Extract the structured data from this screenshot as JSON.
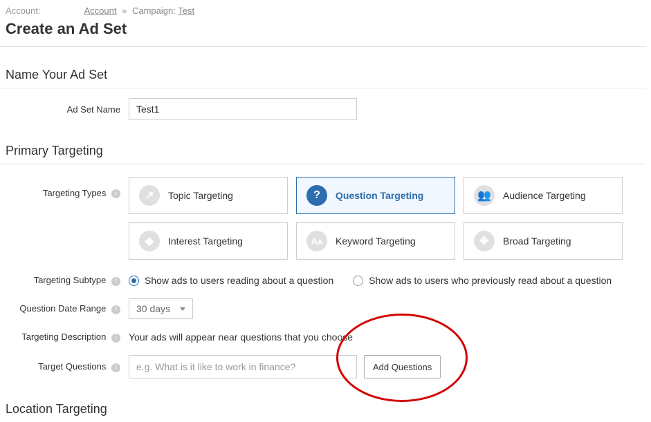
{
  "breadcrumb": {
    "label": "Account:",
    "account_link": "Account",
    "campaign_label": "Campaign:",
    "campaign_name": "Test"
  },
  "page_title": "Create an Ad Set",
  "sections": {
    "name": {
      "title": "Name Your Ad Set",
      "field_label": "Ad Set Name",
      "field_value": "Test1"
    },
    "primary": {
      "title": "Primary Targeting",
      "types_label": "Targeting Types",
      "types": [
        {
          "label": "Topic Targeting",
          "icon": "↗"
        },
        {
          "label": "Question Targeting",
          "icon": "?",
          "active": true
        },
        {
          "label": "Audience Targeting",
          "icon": "👥"
        },
        {
          "label": "Interest Targeting",
          "icon": "◆"
        },
        {
          "label": "Keyword Targeting",
          "icon": "Aᴀ"
        },
        {
          "label": "Broad Targeting",
          "icon": "✥"
        }
      ],
      "subtype_label": "Targeting Subtype",
      "subtype_options": [
        "Show ads to users reading about a question",
        "Show ads to users who previously read about a question"
      ],
      "date_range_label": "Question Date Range",
      "date_range_value": "30 days",
      "description_label": "Targeting Description",
      "description_text": "Your ads will appear near questions that you choose",
      "target_questions_label": "Target Questions",
      "target_questions_placeholder": "e.g. What is it like to work in finance?",
      "add_button": "Add Questions"
    },
    "location": {
      "title": "Location Targeting"
    }
  },
  "info_glyph": "i"
}
